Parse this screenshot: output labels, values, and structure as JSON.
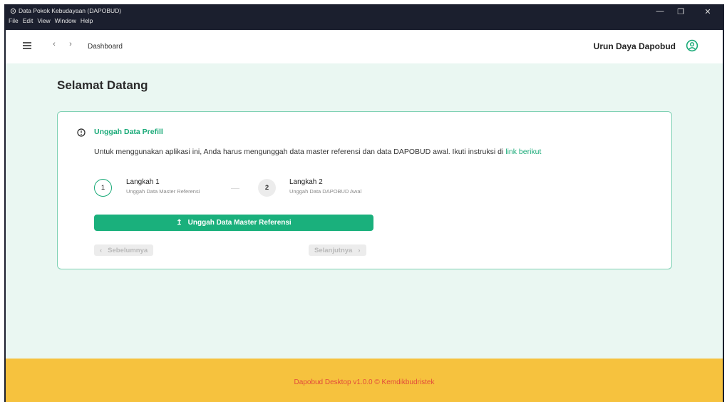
{
  "window": {
    "title": "Data Pokok Kebudayaan (DAPOBUD)",
    "menu": [
      "File",
      "Edit",
      "View",
      "Window",
      "Help"
    ],
    "minimize": "—",
    "restore": "❐",
    "close": "✕"
  },
  "header": {
    "breadcrumb": "Dashboard",
    "back": "‹",
    "forward": "›",
    "user_name": "Urun Daya Dapobud"
  },
  "main": {
    "page_title": "Selamat Datang",
    "alert": {
      "title": "Unggah Data Prefill",
      "description": "Untuk menggunakan aplikasi ini, Anda harus mengunggah data master referensi dan data DAPOBUD awal. Ikuti instruksi di ",
      "link_text": "link berikut"
    },
    "steps": [
      {
        "number": "1",
        "title": "Langkah 1",
        "subtitle": "Unggah Data Master Referensi"
      },
      {
        "number": "2",
        "title": "Langkah 2",
        "subtitle": "Unggah Data DAPOBUD Awal"
      }
    ],
    "upload_button": "Unggah Data Master Referensi",
    "prev_button": "Sebelumnya",
    "next_button": "Selanjutnya",
    "prev_icon": "‹",
    "next_icon": "›",
    "upload_icon": "↥"
  },
  "footer": {
    "text": "Dapobud Desktop v1.0.0 © Kemdikbudristek"
  },
  "colors": {
    "accent": "#1ab07c",
    "footer_bg": "#f6c23e",
    "footer_text": "#e24b3b",
    "page_bg": "#eaf7f2",
    "titlebar_bg": "#1b1f2e"
  }
}
